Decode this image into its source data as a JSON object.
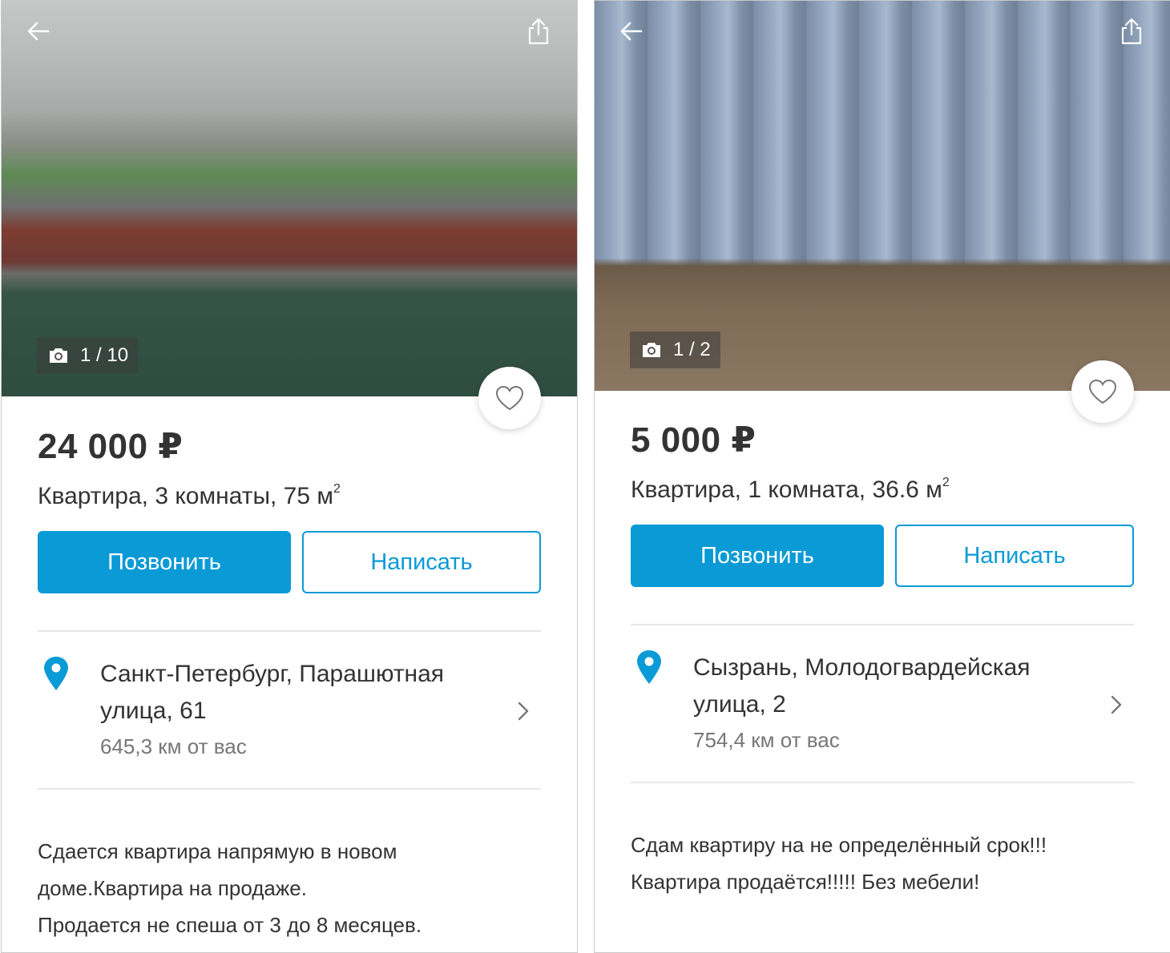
{
  "colors": {
    "accent": "#0a9ad6",
    "pin": "#0a9ad6",
    "text": "#333333",
    "muted": "#777777"
  },
  "listings": [
    {
      "photo": {
        "counter": "1 / 10"
      },
      "price": "24 000 ₽",
      "title": "Квартира, 3 комнаты, 75 м",
      "title_sup": "2",
      "buttons": {
        "call": "Позвонить",
        "write": "Написать"
      },
      "address_line1": "Санкт-Петербург, Парашютная",
      "address_line2": "улица, 61",
      "distance": "645,3  км от вас",
      "description": [
        "Сдается квартира напрямую в новом",
        "доме.Квартира на продаже.",
        "Продается не спеша от 3 до 8 месяцев."
      ]
    },
    {
      "photo": {
        "counter": "1 / 2"
      },
      "price": "5 000 ₽",
      "title": "Квартира, 1 комната, 36.6 м",
      "title_sup": "2",
      "buttons": {
        "call": "Позвонить",
        "write": "Написать"
      },
      "address_line1": "Сызрань, Молодогвардейская",
      "address_line2": "улица, 2",
      "distance": "754,4  км от вас",
      "description": [
        "Сдам квартиру на не определённый срок!!!",
        "Квартира продаётся!!!!! Без мебели!"
      ]
    }
  ]
}
